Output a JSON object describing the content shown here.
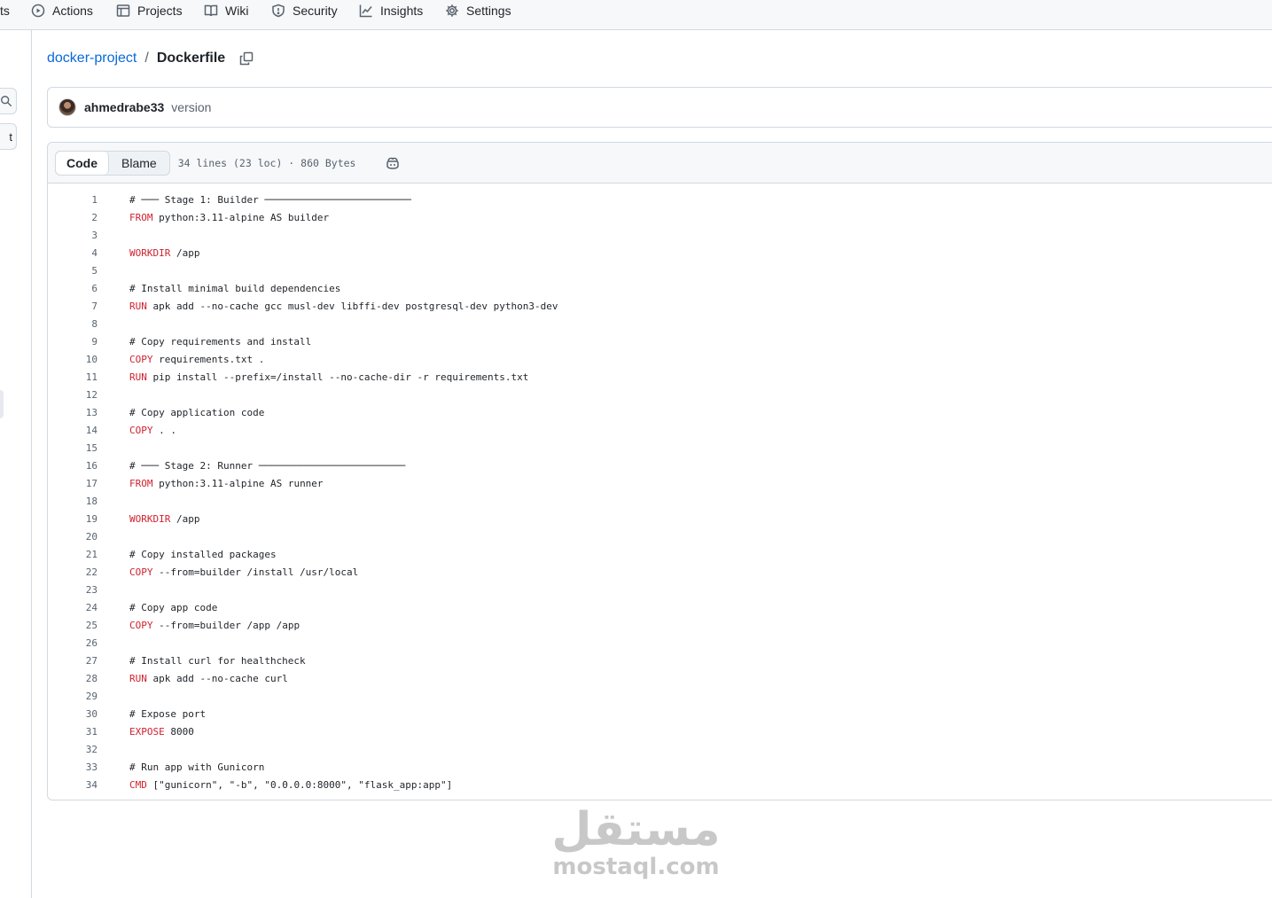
{
  "nav": {
    "items": [
      {
        "label": "ts",
        "icon": ""
      },
      {
        "label": "Actions",
        "icon": "play-circle-icon"
      },
      {
        "label": "Projects",
        "icon": "table-icon"
      },
      {
        "label": "Wiki",
        "icon": "book-icon"
      },
      {
        "label": "Security",
        "icon": "shield-icon"
      },
      {
        "label": "Insights",
        "icon": "graph-icon"
      },
      {
        "label": "Settings",
        "icon": "gear-icon"
      }
    ]
  },
  "sidebar": {
    "filter_fragment": "t"
  },
  "breadcrumb": {
    "repo": "docker-project",
    "separator": "/",
    "file": "Dockerfile"
  },
  "commit": {
    "author": "ahmedrabe33",
    "message": "version"
  },
  "file": {
    "tabs": [
      "Code",
      "Blame"
    ],
    "active_tab": "Code",
    "meta": "34 lines (23 loc) · 860 Bytes",
    "lines": [
      {
        "num": "1",
        "kw": "",
        "rest": "# ─── Stage 1: Builder ─────────────────────────"
      },
      {
        "num": "2",
        "kw": "FROM",
        "rest": " python:3.11-alpine AS builder"
      },
      {
        "num": "3",
        "kw": "",
        "rest": ""
      },
      {
        "num": "4",
        "kw": "WORKDIR",
        "rest": " /app"
      },
      {
        "num": "5",
        "kw": "",
        "rest": ""
      },
      {
        "num": "6",
        "kw": "",
        "rest": "# Install minimal build dependencies"
      },
      {
        "num": "7",
        "kw": "RUN",
        "rest": " apk add --no-cache gcc musl-dev libffi-dev postgresql-dev python3-dev"
      },
      {
        "num": "8",
        "kw": "",
        "rest": ""
      },
      {
        "num": "9",
        "kw": "",
        "rest": "# Copy requirements and install"
      },
      {
        "num": "10",
        "kw": "COPY",
        "rest": " requirements.txt ."
      },
      {
        "num": "11",
        "kw": "RUN",
        "rest": " pip install --prefix=/install --no-cache-dir -r requirements.txt"
      },
      {
        "num": "12",
        "kw": "",
        "rest": ""
      },
      {
        "num": "13",
        "kw": "",
        "rest": "# Copy application code"
      },
      {
        "num": "14",
        "kw": "COPY",
        "rest": " . ."
      },
      {
        "num": "15",
        "kw": "",
        "rest": ""
      },
      {
        "num": "16",
        "kw": "",
        "rest": "# ─── Stage 2: Runner ─────────────────────────"
      },
      {
        "num": "17",
        "kw": "FROM",
        "rest": " python:3.11-alpine AS runner"
      },
      {
        "num": "18",
        "kw": "",
        "rest": ""
      },
      {
        "num": "19",
        "kw": "WORKDIR",
        "rest": " /app"
      },
      {
        "num": "20",
        "kw": "",
        "rest": ""
      },
      {
        "num": "21",
        "kw": "",
        "rest": "# Copy installed packages"
      },
      {
        "num": "22",
        "kw": "COPY",
        "rest": " --from=builder /install /usr/local"
      },
      {
        "num": "23",
        "kw": "",
        "rest": ""
      },
      {
        "num": "24",
        "kw": "",
        "rest": "# Copy app code"
      },
      {
        "num": "25",
        "kw": "COPY",
        "rest": " --from=builder /app /app"
      },
      {
        "num": "26",
        "kw": "",
        "rest": ""
      },
      {
        "num": "27",
        "kw": "",
        "rest": "# Install curl for healthcheck"
      },
      {
        "num": "28",
        "kw": "RUN",
        "rest": " apk add --no-cache curl"
      },
      {
        "num": "29",
        "kw": "",
        "rest": ""
      },
      {
        "num": "30",
        "kw": "",
        "rest": "# Expose port"
      },
      {
        "num": "31",
        "kw": "EXPOSE",
        "rest": " 8000"
      },
      {
        "num": "32",
        "kw": "",
        "rest": ""
      },
      {
        "num": "33",
        "kw": "",
        "rest": "# Run app with Gunicorn"
      },
      {
        "num": "34",
        "kw": "CMD",
        "rest": " [\"gunicorn\", \"-b\", \"0.0.0.0:8000\", \"flask_app:app\"]"
      }
    ]
  },
  "watermark": {
    "arabic": "مستقل",
    "latin": "mostaql.com"
  },
  "colors": {
    "link": "#0969da",
    "keyword": "#cf222e",
    "muted": "#59636e",
    "border": "#d1d9e0",
    "header_bg": "#f6f8fa"
  }
}
